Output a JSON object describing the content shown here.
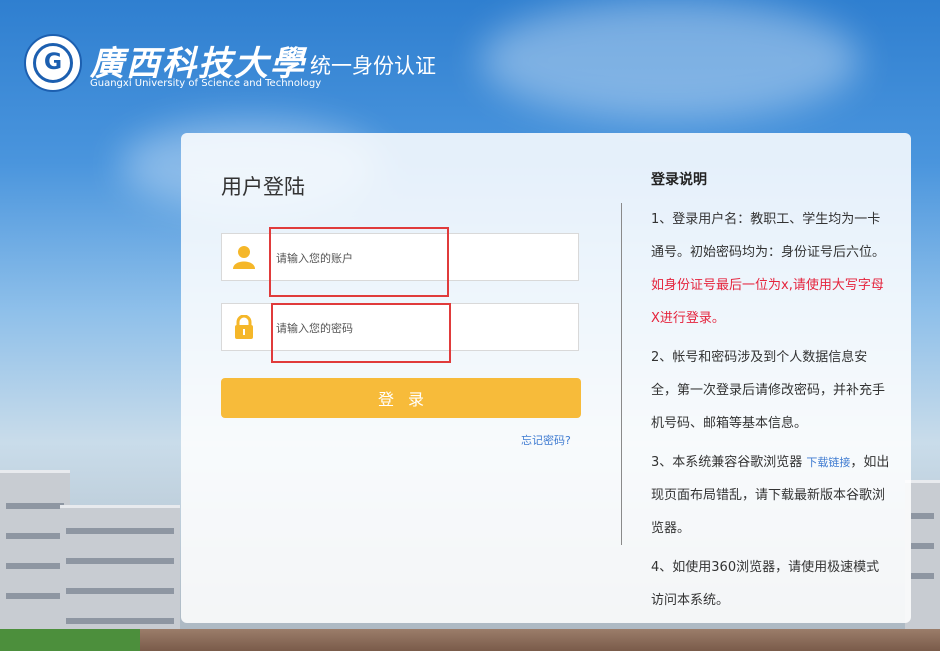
{
  "header": {
    "university_name": "廣西科技大學",
    "university_name_en": "Guangxi University of Science and Technology",
    "system_title": "统一身份认证"
  },
  "login": {
    "title": "用户登陆",
    "username_placeholder": "请输入您的账户",
    "password_placeholder": "请输入您的密码",
    "submit_label": "登录",
    "forgot_label": "忘记密码?"
  },
  "instructions": {
    "title": "登录说明",
    "item1_text": "1、登录用户名：教职工、学生均为一卡通号。初始密码均为：身份证号后六位。",
    "item1_highlight": "如身份证号最后一位为x,请使用大写字母X进行登录。",
    "item2_text": "2、帐号和密码涉及到个人数据信息安全，第一次登录后请修改密码，并补充手机号码、邮箱等基本信息。",
    "item3_text": "3、本系统兼容谷歌浏览器",
    "item3_link": "下载链接",
    "item3_text2": "，如出现页面布局错乱，请下载最新版本谷歌浏览器。",
    "item4_text": "4、如使用360浏览器，请使用极速模式访问本系统。"
  },
  "colors": {
    "accent_button": "#f7bb3a",
    "icon_yellow": "#f5b729",
    "highlight_red": "#e5243d",
    "link_blue": "#3f7bd1",
    "annotation_box": "#e03b3b"
  },
  "icons": {
    "logo": "university-seal-logo",
    "user": "user-icon",
    "lock": "lock-icon"
  }
}
